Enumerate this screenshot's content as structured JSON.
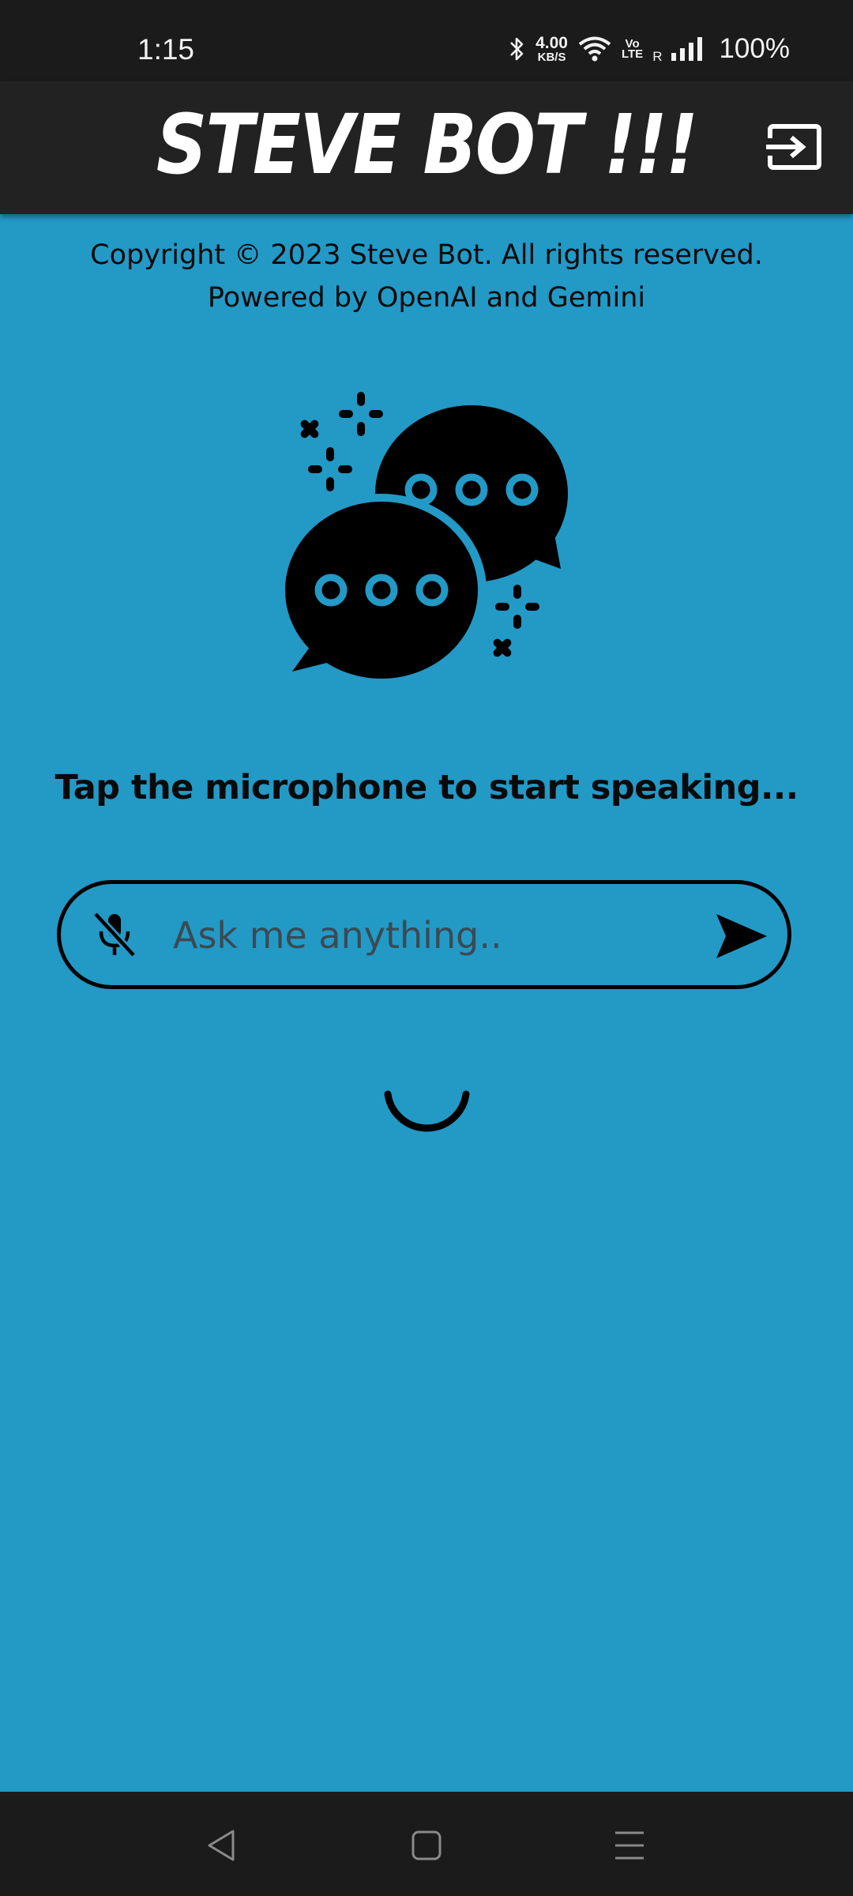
{
  "status_bar": {
    "time": "1:15",
    "net_speed_value": "4.00",
    "net_speed_unit": "KB/S",
    "volte_top": "Vo",
    "volte_bottom": "LTE",
    "roaming": "R",
    "battery": "100%",
    "icons": [
      "bluetooth-icon",
      "wifi-icon",
      "signal-icon"
    ]
  },
  "header": {
    "title": "STEVE BOT !!!",
    "login_icon": "login-icon"
  },
  "footer_text": {
    "copyright": "Copyright © 2023 Steve Bot. All rights reserved.",
    "powered_by": "Powered by OpenAI and Gemini"
  },
  "hero": {
    "icon": "chat-bubbles-icon"
  },
  "hint": "Tap the microphone to start speaking...",
  "query": {
    "value": "",
    "placeholder": "Ask me anything..",
    "mic_icon": "mic-off-icon",
    "send_icon": "send-icon"
  },
  "loading": {
    "icon": "loading-spinner"
  },
  "nav": {
    "icons": [
      "back-icon",
      "home-icon",
      "menu-icon"
    ]
  },
  "colors": {
    "background": "#2399c6",
    "header": "#222222",
    "status_bar": "#1b1b1b",
    "text": "#0a0a0a"
  }
}
